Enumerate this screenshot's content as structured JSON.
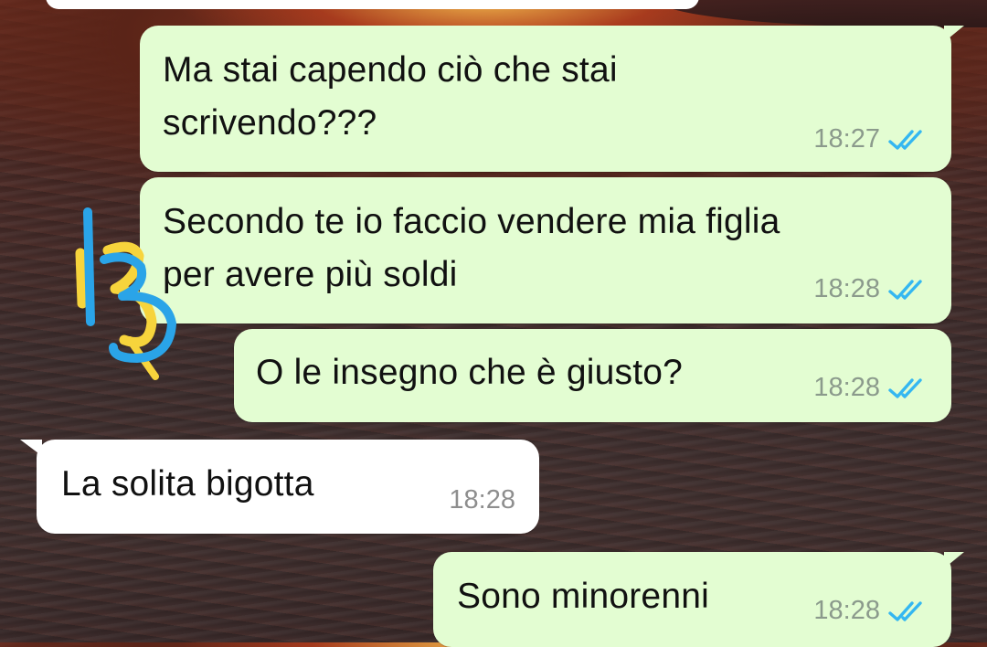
{
  "messages": [
    {
      "direction": "out",
      "lines": [
        "Ma stai capendo ciò che stai",
        "scrivendo???"
      ],
      "time": "18:27",
      "status": "read"
    },
    {
      "direction": "out",
      "lines": [
        "Secondo te io faccio vendere mia figlia",
        "per avere più soldi"
      ],
      "time": "18:28",
      "status": "read"
    },
    {
      "direction": "out",
      "lines": [
        "O le insegno che è giusto?"
      ],
      "time": "18:28",
      "status": "read"
    },
    {
      "direction": "in",
      "lines": [
        "La solita bigotta"
      ],
      "time": "18:28"
    },
    {
      "direction": "out",
      "lines": [
        "Sono minorenni"
      ],
      "time": "18:28",
      "status": "read"
    }
  ],
  "annotation": {
    "text": "13"
  },
  "colors": {
    "outgoing_bubble": "#e3fdd2",
    "incoming_bubble": "#ffffff",
    "read_ticks": "#34b7f1",
    "annotation_blue": "#2aa4e8",
    "annotation_yellow": "#f7d43c"
  },
  "icons": {
    "read_receipt": "double-check-icon"
  }
}
